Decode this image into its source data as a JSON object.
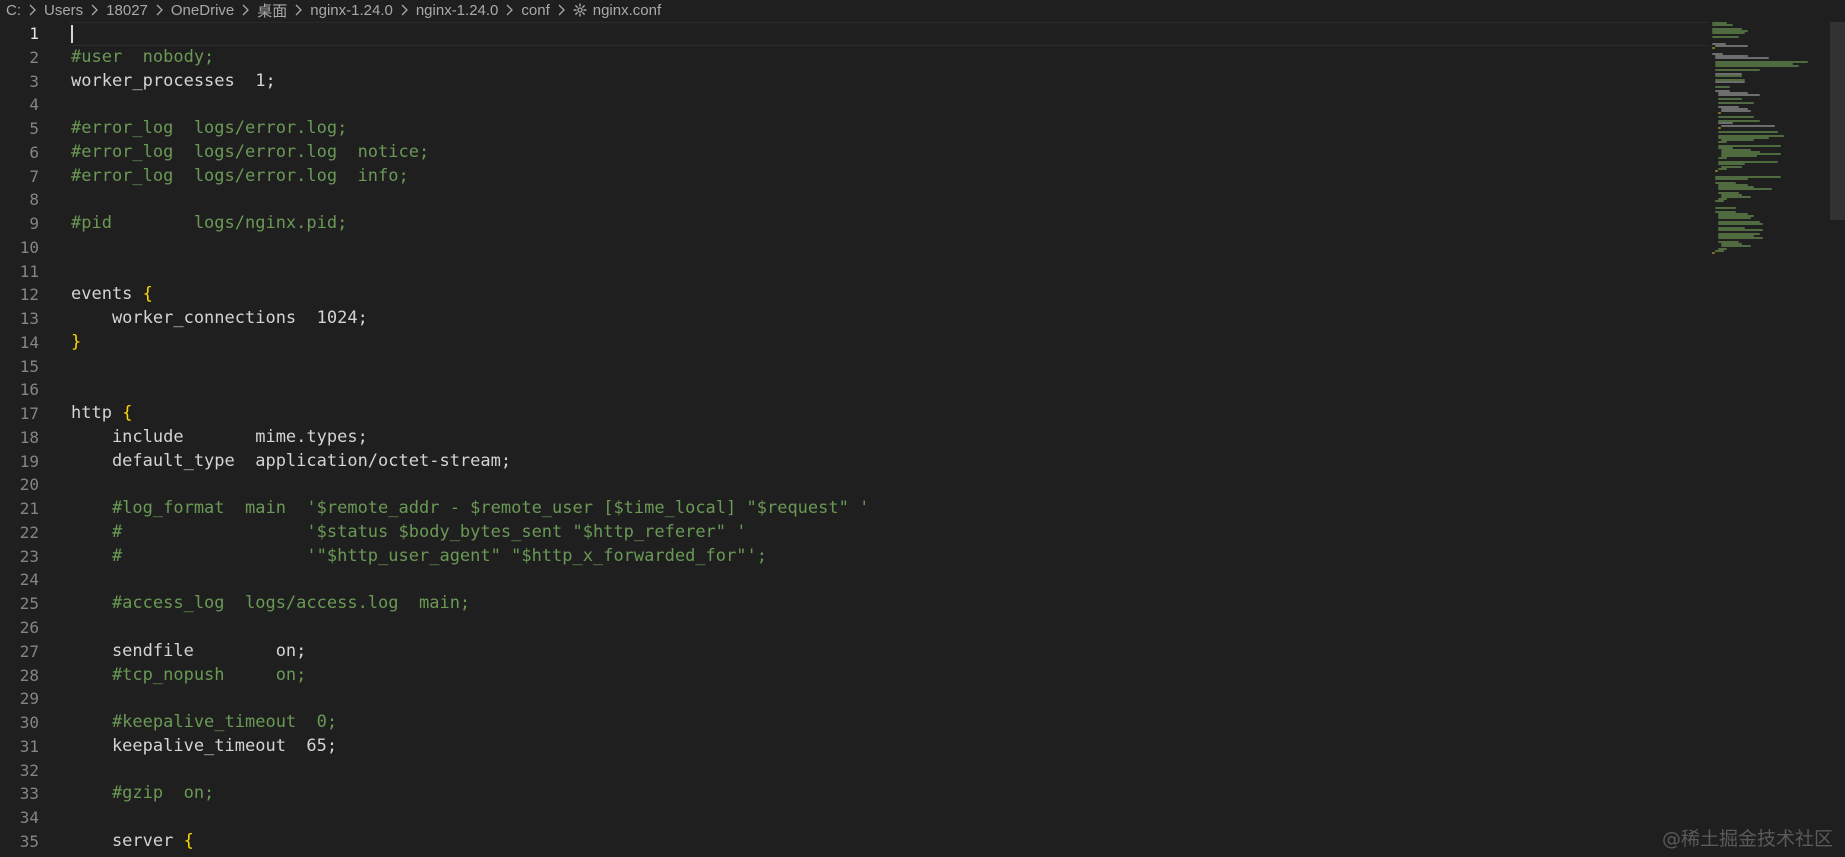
{
  "breadcrumb": {
    "items": [
      "C:",
      "Users",
      "18027",
      "OneDrive",
      "桌面",
      "nginx-1.24.0",
      "nginx-1.24.0",
      "conf",
      "nginx.conf"
    ],
    "file_icon": "gear-icon",
    "separator_icon": "chevron-right-icon"
  },
  "editor": {
    "active_line": 1,
    "lines": [
      {
        "n": "1",
        "tokens": []
      },
      {
        "n": "2",
        "tokens": [
          {
            "t": "comment",
            "v": "#user  nobody;"
          }
        ]
      },
      {
        "n": "3",
        "tokens": [
          {
            "t": "plain",
            "v": "worker_processes  1"
          },
          {
            "t": "punct",
            "v": ";"
          }
        ]
      },
      {
        "n": "4",
        "tokens": []
      },
      {
        "n": "5",
        "tokens": [
          {
            "t": "comment",
            "v": "#error_log  logs/error.log;"
          }
        ]
      },
      {
        "n": "6",
        "tokens": [
          {
            "t": "comment",
            "v": "#error_log  logs/error.log  notice;"
          }
        ]
      },
      {
        "n": "7",
        "tokens": [
          {
            "t": "comment",
            "v": "#error_log  logs/error.log  info;"
          }
        ]
      },
      {
        "n": "8",
        "tokens": []
      },
      {
        "n": "9",
        "tokens": [
          {
            "t": "comment",
            "v": "#pid        logs/nginx.pid;"
          }
        ]
      },
      {
        "n": "10",
        "tokens": []
      },
      {
        "n": "11",
        "tokens": []
      },
      {
        "n": "12",
        "tokens": [
          {
            "t": "plain",
            "v": "events "
          },
          {
            "t": "brace",
            "v": "{"
          }
        ]
      },
      {
        "n": "13",
        "tokens": [
          {
            "t": "plain",
            "v": "    worker_connections  1024"
          },
          {
            "t": "punct",
            "v": ";"
          }
        ]
      },
      {
        "n": "14",
        "tokens": [
          {
            "t": "brace",
            "v": "}"
          }
        ]
      },
      {
        "n": "15",
        "tokens": []
      },
      {
        "n": "16",
        "tokens": []
      },
      {
        "n": "17",
        "tokens": [
          {
            "t": "plain",
            "v": "http "
          },
          {
            "t": "brace",
            "v": "{"
          }
        ]
      },
      {
        "n": "18",
        "tokens": [
          {
            "t": "plain",
            "v": "    include       mime.types"
          },
          {
            "t": "punct",
            "v": ";"
          }
        ]
      },
      {
        "n": "19",
        "tokens": [
          {
            "t": "plain",
            "v": "    default_type  application/octet-stream"
          },
          {
            "t": "punct",
            "v": ";"
          }
        ]
      },
      {
        "n": "20",
        "tokens": []
      },
      {
        "n": "21",
        "tokens": [
          {
            "t": "comment",
            "v": "    #log_format  main  '$remote_addr - $remote_user [$time_local] \"$request\" '"
          }
        ]
      },
      {
        "n": "22",
        "tokens": [
          {
            "t": "comment",
            "v": "    #                  '$status $body_bytes_sent \"$http_referer\" '"
          }
        ]
      },
      {
        "n": "23",
        "tokens": [
          {
            "t": "comment",
            "v": "    #                  '\"$http_user_agent\" \"$http_x_forwarded_for\"';"
          }
        ]
      },
      {
        "n": "24",
        "tokens": []
      },
      {
        "n": "25",
        "tokens": [
          {
            "t": "comment",
            "v": "    #access_log  logs/access.log  main;"
          }
        ]
      },
      {
        "n": "26",
        "tokens": []
      },
      {
        "n": "27",
        "tokens": [
          {
            "t": "plain",
            "v": "    sendfile        on"
          },
          {
            "t": "punct",
            "v": ";"
          }
        ]
      },
      {
        "n": "28",
        "tokens": [
          {
            "t": "comment",
            "v": "    #tcp_nopush     on;"
          }
        ]
      },
      {
        "n": "29",
        "tokens": []
      },
      {
        "n": "30",
        "tokens": [
          {
            "t": "comment",
            "v": "    #keepalive_timeout  0;"
          }
        ]
      },
      {
        "n": "31",
        "tokens": [
          {
            "t": "plain",
            "v": "    keepalive_timeout  65"
          },
          {
            "t": "punct",
            "v": ";"
          }
        ]
      },
      {
        "n": "32",
        "tokens": []
      },
      {
        "n": "33",
        "tokens": [
          {
            "t": "comment",
            "v": "    #gzip  on;"
          }
        ]
      },
      {
        "n": "34",
        "tokens": []
      },
      {
        "n": "35",
        "tokens": [
          {
            "t": "plain",
            "v": "    server "
          },
          {
            "t": "brace",
            "v": "{"
          }
        ]
      }
    ]
  },
  "watermark": "@稀土掘金技术社区",
  "colors": {
    "background": "#1f1f1f",
    "comment": "#6a9955",
    "brace": "#ffd700",
    "text": "#d4d4d4",
    "line_number": "#858585"
  }
}
